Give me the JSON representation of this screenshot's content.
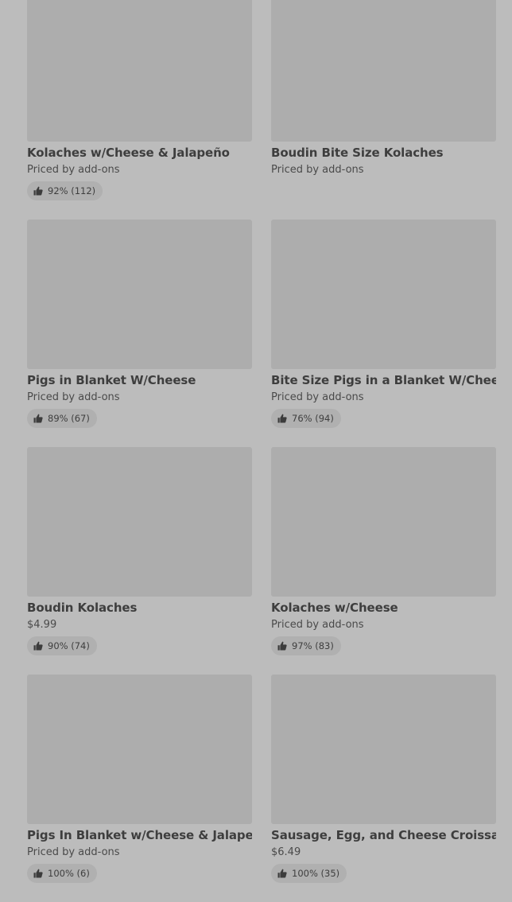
{
  "products": [
    {
      "name": "Kolaches w/Cheese & Jalapeño",
      "price": "Priced by add-ons",
      "rating": "92% (112)",
      "thumb_icon": "thumbs-up-icon"
    },
    {
      "name": "Boudin Bite Size Kolaches",
      "price": "Priced by add-ons",
      "rating": ""
    },
    {
      "name": "Pigs in Blanket W/Cheese",
      "price": "Priced by add-ons",
      "rating": "89% (67)",
      "thumb_icon": "thumbs-up-icon"
    },
    {
      "name": "Bite Size Pigs in a Blanket W/Cheese",
      "price": "Priced by add-ons",
      "rating": "76% (94)",
      "thumb_icon": "thumbs-up-icon"
    },
    {
      "name": "Boudin Kolaches",
      "price": "$4.99",
      "rating": "90% (74)",
      "thumb_icon": "thumbs-up-icon"
    },
    {
      "name": "Kolaches w/Cheese",
      "price": "Priced by add-ons",
      "rating": "97% (83)",
      "thumb_icon": "thumbs-up-icon"
    },
    {
      "name": "Pigs In Blanket w/Cheese & Jalapeño",
      "price": "Priced by add-ons",
      "rating": "100% (6)",
      "thumb_icon": "thumbs-up-icon"
    },
    {
      "name": "Sausage, Egg, and Cheese Croissant",
      "price": "$6.49",
      "rating": "100% (35)",
      "thumb_icon": "thumbs-up-icon"
    }
  ],
  "colors": {
    "background": "#bcbcbc",
    "image_placeholder": "#adadad",
    "badge": "#b0b0b0",
    "text": "#3e3e3e"
  }
}
